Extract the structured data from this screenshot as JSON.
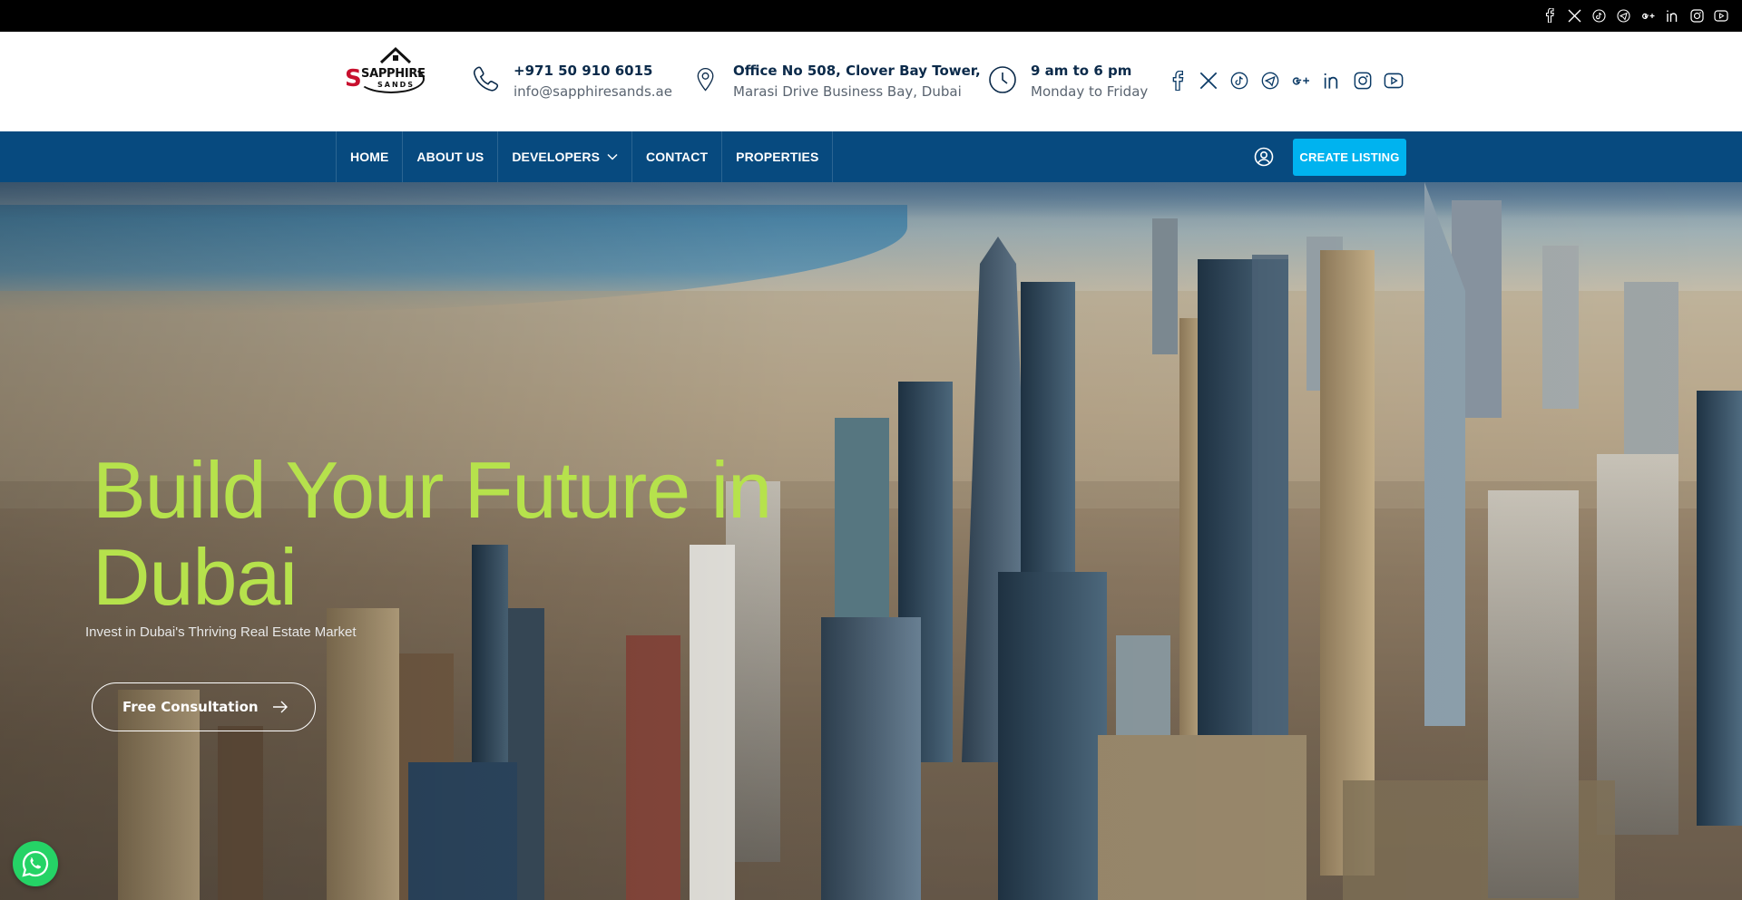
{
  "topbar": {
    "social_icons": [
      "facebook-icon",
      "x-icon",
      "tiktok-icon",
      "telegram-icon",
      "google-plus-icon",
      "linkedin-icon",
      "instagram-icon",
      "youtube-icon"
    ]
  },
  "logo": {
    "brand_line1": "SAPPHIRE",
    "brand_line2": "SANDS"
  },
  "contact": {
    "phone": "+971 50 910 6015",
    "email": "info@sapphiresands.ae",
    "address_line1": "Office No 508, Clover Bay Tower,",
    "address_line2": "Marasi Drive Business Bay, Dubai",
    "hours": "9 am to 6 pm",
    "days": "Monday to Friday"
  },
  "nav": {
    "items": [
      {
        "label": "HOME"
      },
      {
        "label": "ABOUT US"
      },
      {
        "label": "DEVELOPERS"
      },
      {
        "label": "CONTACT"
      },
      {
        "label": "PROPERTIES"
      }
    ],
    "cta_label": "CREATE LISTING"
  },
  "hero": {
    "title": "Build Your Future in Dubai",
    "subtitle": "Invest in Dubai's Thriving Real Estate Market",
    "button_label": "Free Consultation"
  },
  "colors": {
    "nav_bg": "#074a7f",
    "cta_bg": "#00b3ef",
    "hero_title": "#b6e24c",
    "whatsapp": "#25d366"
  }
}
